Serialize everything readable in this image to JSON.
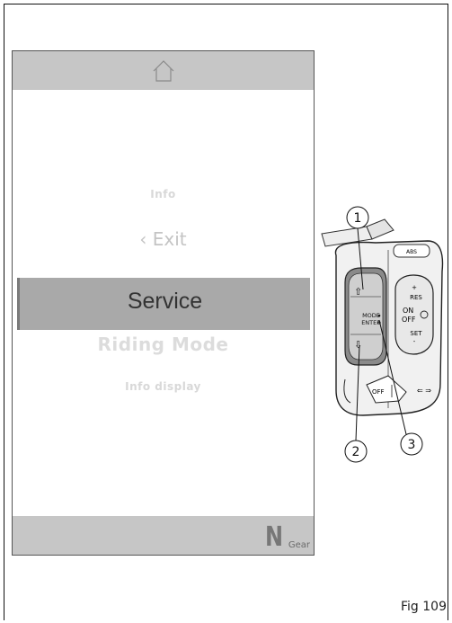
{
  "display": {
    "home_icon": "home-icon",
    "menu": {
      "item_info": "Info",
      "item_exit": "Exit",
      "item_selected": "Service",
      "item_riding_mode": "Riding Mode",
      "item_info_display": "Info display"
    },
    "gear": {
      "value": "N",
      "label": "Gear"
    }
  },
  "switch_block": {
    "labels": {
      "mode": "MODE",
      "enter": "ENTER",
      "on": "ON",
      "off": "OFF",
      "res": "RES",
      "set": "SET",
      "abs": "ABS",
      "off_switch": "OFF"
    },
    "callouts": [
      "1",
      "2",
      "3"
    ]
  },
  "figure_label": "Fig 109"
}
